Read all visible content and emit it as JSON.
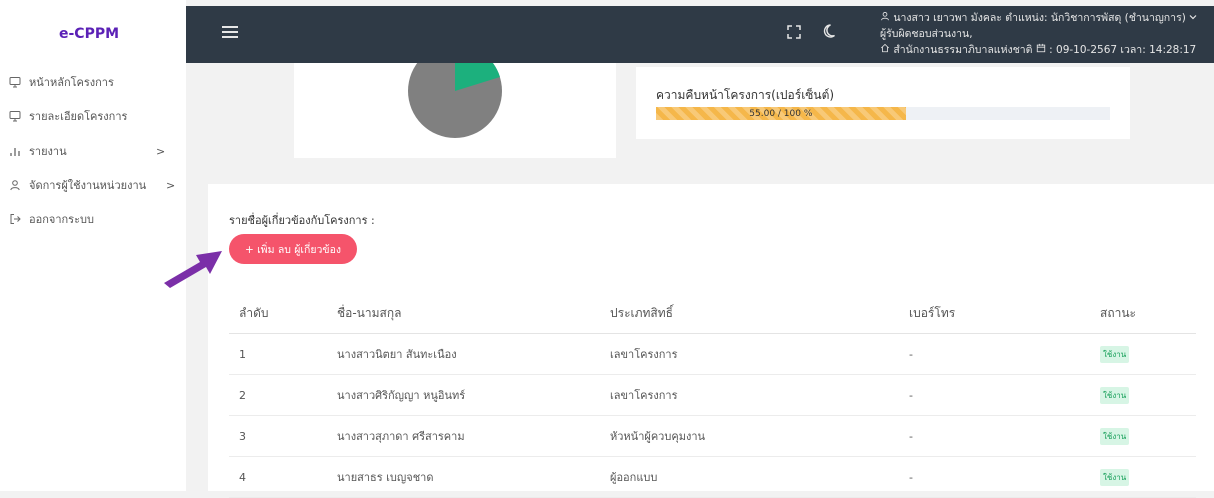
{
  "app": {
    "brand": "e-CPPM"
  },
  "sidebar": {
    "items": [
      {
        "label": "หน้าหลักโครงการ",
        "icon": "monitor-icon"
      },
      {
        "label": "รายละเอียดโครงการ",
        "icon": "monitor-icon"
      },
      {
        "label": "รายงาน",
        "icon": "bar-chart-icon",
        "chevron": ">"
      },
      {
        "label": "จัดการผู้ใช้งานหน่วยงาน",
        "icon": "user-icon",
        "chevron": ">"
      },
      {
        "label": "ออกจากระบบ",
        "icon": "logout-icon"
      }
    ]
  },
  "header": {
    "user_line": "นางสาว เยาวพา มังคละ ตำแหน่ง: นักวิชาการพัสดุ (ชำนาญการ)",
    "role_line": "ผู้รับผิดชอบส่วนงาน,",
    "org_line": "สำนักงานธรรมาภิบาลแห่งชาติ",
    "date_time": ": 09-10-2567 เวลา: 14:28:17"
  },
  "progress": {
    "label": "ความคืบหน้าโครงการ(เปอร์เซ็นต์)",
    "text": "55.00 / 100 %",
    "value_percent": 55,
    "color": "#f5b74a"
  },
  "pie": {
    "color_main": "#808080",
    "color_slice": "#1cb07d"
  },
  "related": {
    "title": "รายชื่อผู้เกี่ยวข้องกับโครงการ :",
    "add_button": "+ เพิ่ม ลบ ผู้เกี่ยวข้อง",
    "columns": [
      "ลำดับ",
      "ชื่อ-นามสกุล",
      "ประเภทสิทธิ์",
      "เบอร์โทร",
      "สถานะ"
    ],
    "rows": [
      {
        "no": "1",
        "name": "นางสาวนิตยา สันทะเนือง",
        "role": "เลขาโครงการ",
        "phone": "-",
        "status": "ใช้งาน"
      },
      {
        "no": "2",
        "name": "นางสาวศิริกัญญา หนูอินทร์",
        "role": "เลขาโครงการ",
        "phone": "-",
        "status": "ใช้งาน"
      },
      {
        "no": "3",
        "name": "นางสาวสุภาดา ศรีสารคาม",
        "role": "หัวหน้าผู้ควบคุมงาน",
        "phone": "-",
        "status": "ใช้งาน"
      },
      {
        "no": "4",
        "name": "นายสาธร เบญจชาด",
        "role": "ผู้ออกแบบ",
        "phone": "-",
        "status": "ใช้งาน"
      }
    ]
  },
  "annotation": {
    "arrow_color": "#7b2fa8"
  }
}
